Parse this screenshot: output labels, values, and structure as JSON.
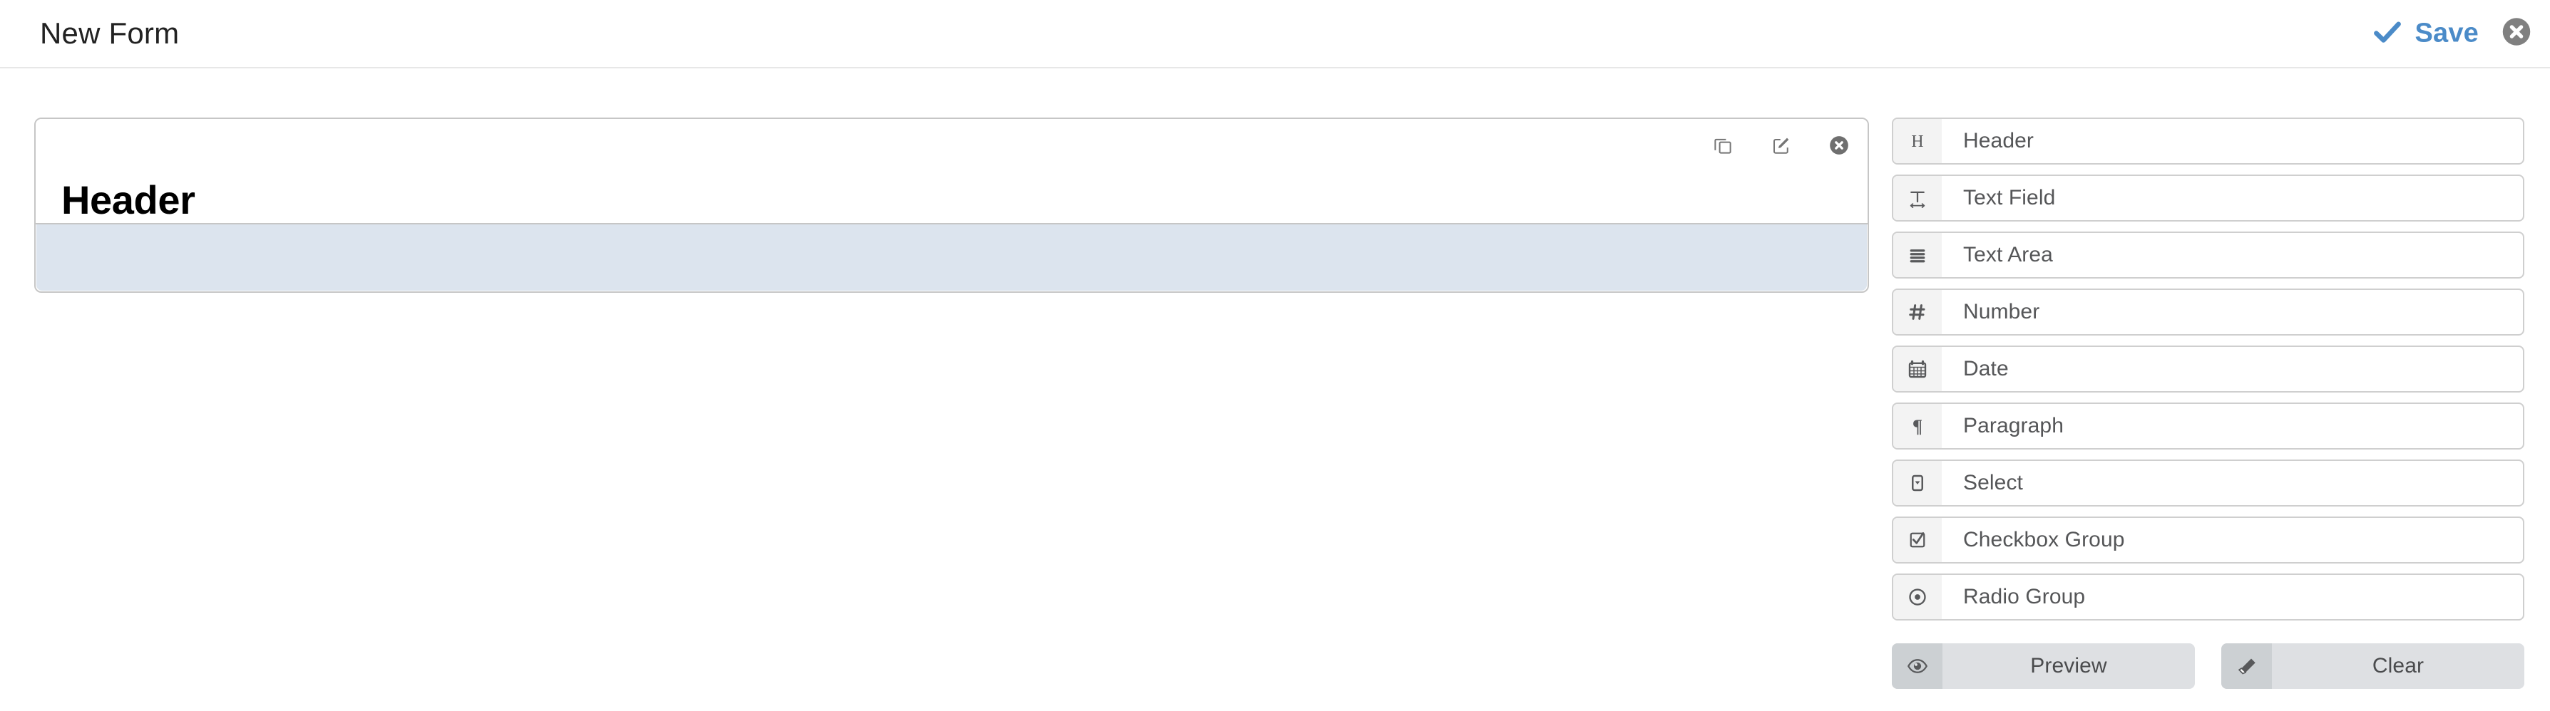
{
  "topbar": {
    "title": "New Form",
    "save_label": "Save",
    "save_icon": "check-icon",
    "save_color": "#4b8bc8",
    "close_icon": "close-circle-icon",
    "close_color": "#808080"
  },
  "canvas": {
    "field": {
      "type": "header",
      "text": "Header",
      "actions": [
        {
          "name": "copy-icon",
          "title": "Copy"
        },
        {
          "name": "edit-icon",
          "title": "Edit"
        },
        {
          "name": "remove-icon",
          "title": "Remove"
        }
      ]
    },
    "dropzone": {
      "label": "",
      "color": "#dce4ee"
    }
  },
  "sidebar": {
    "items": [
      {
        "label": "Header",
        "icon": "heading-icon"
      },
      {
        "label": "Text Field",
        "icon": "text-width-icon"
      },
      {
        "label": "Text Area",
        "icon": "align-justify-icon"
      },
      {
        "label": "Number",
        "icon": "hashtag-icon"
      },
      {
        "label": "Date",
        "icon": "calendar-icon"
      },
      {
        "label": "Paragraph",
        "icon": "paragraph-icon"
      },
      {
        "label": "Select",
        "icon": "caret-square-down-icon"
      },
      {
        "label": "Checkbox Group",
        "icon": "check-square-icon"
      },
      {
        "label": "Radio Group",
        "icon": "dot-circle-icon"
      }
    ]
  },
  "actions": {
    "buttons": [
      {
        "label": "Preview",
        "icon": "eye-icon"
      },
      {
        "label": "Clear",
        "icon": "eraser-icon"
      }
    ]
  }
}
